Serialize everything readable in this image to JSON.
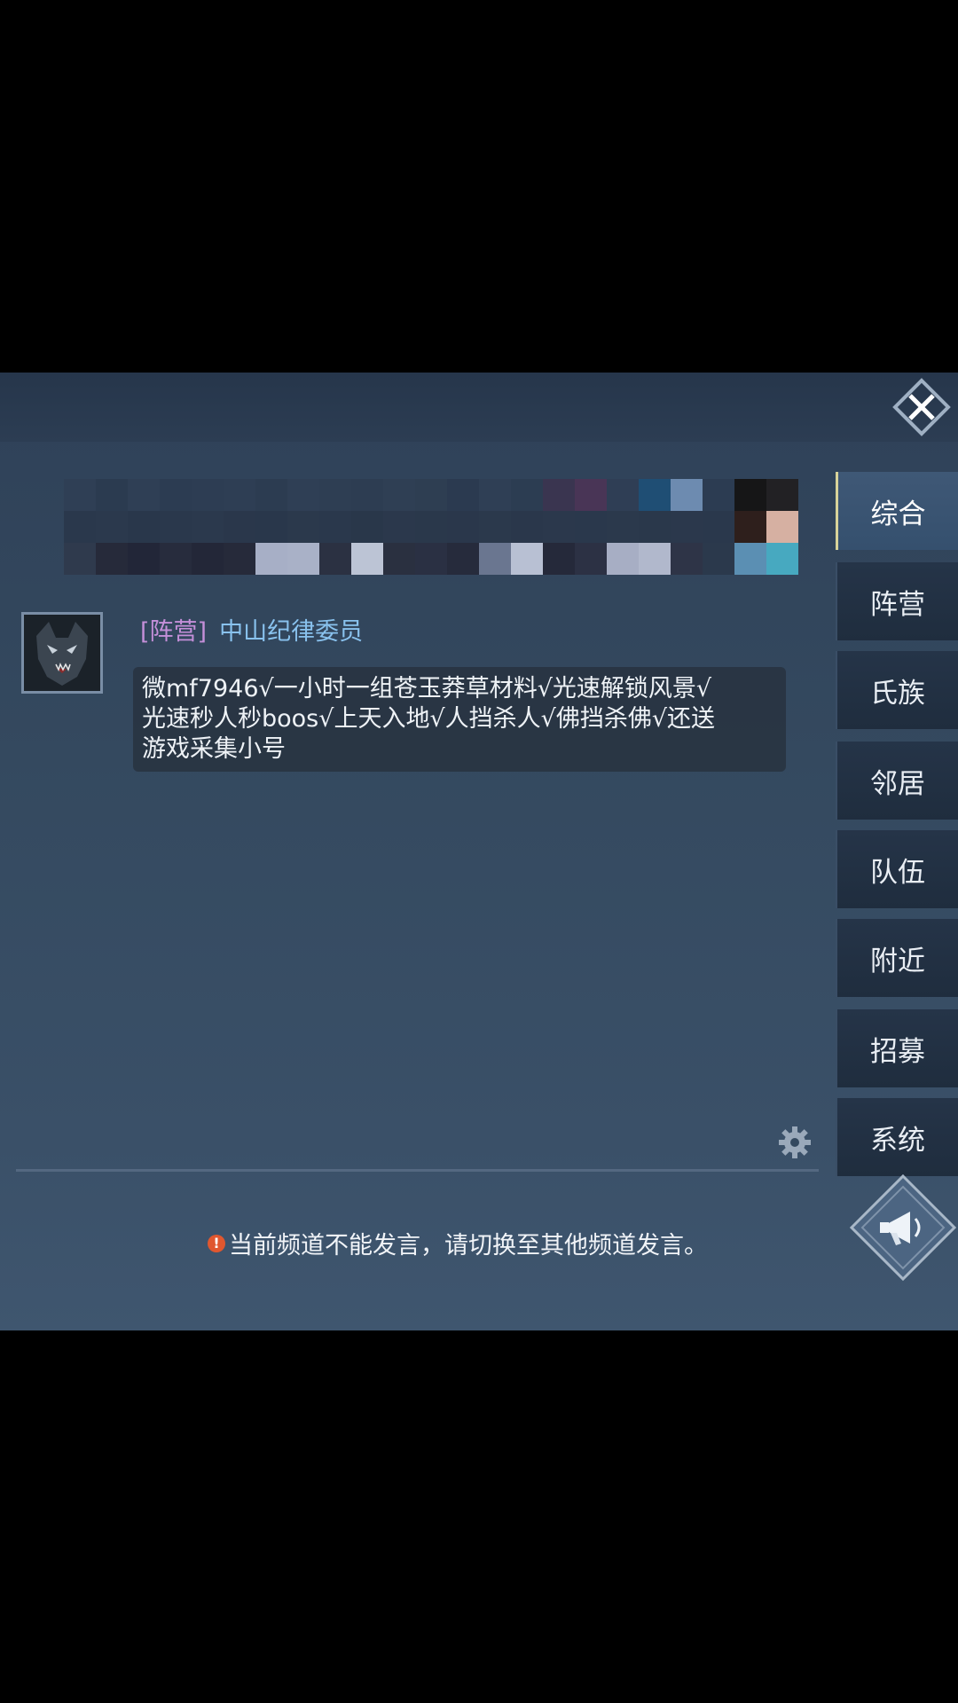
{
  "tabs": [
    {
      "label": "综合",
      "active": true
    },
    {
      "label": "阵营",
      "active": false
    },
    {
      "label": "氏族",
      "active": false
    },
    {
      "label": "邻居",
      "active": false
    },
    {
      "label": "队伍",
      "active": false
    },
    {
      "label": "附近",
      "active": false
    },
    {
      "label": "招募",
      "active": false
    },
    {
      "label": "系统",
      "active": false
    }
  ],
  "message": {
    "channel_tag": "[阵营]",
    "sender": "中山纪律委员",
    "lines": [
      "微mf7946√一小时一组苍玉莽草材料√光速解锁风景√",
      "光速秒人秒boos√上天入地√人挡杀人√佛挡杀佛√还送",
      "游戏采集小号"
    ]
  },
  "notice": {
    "icon": "!",
    "text": "当前频道不能发言，请切换至其他频道发言。"
  },
  "icons": {
    "close": "close-icon",
    "settings": "gear-icon",
    "horn": "megaphone-icon",
    "avatar": "wolf-avatar"
  },
  "colors": {
    "channel_tag": "#c48fd9",
    "sender_name": "#89c2ee",
    "notice_icon": "#e0572f",
    "active_tab_accent": "#d8d39a"
  }
}
